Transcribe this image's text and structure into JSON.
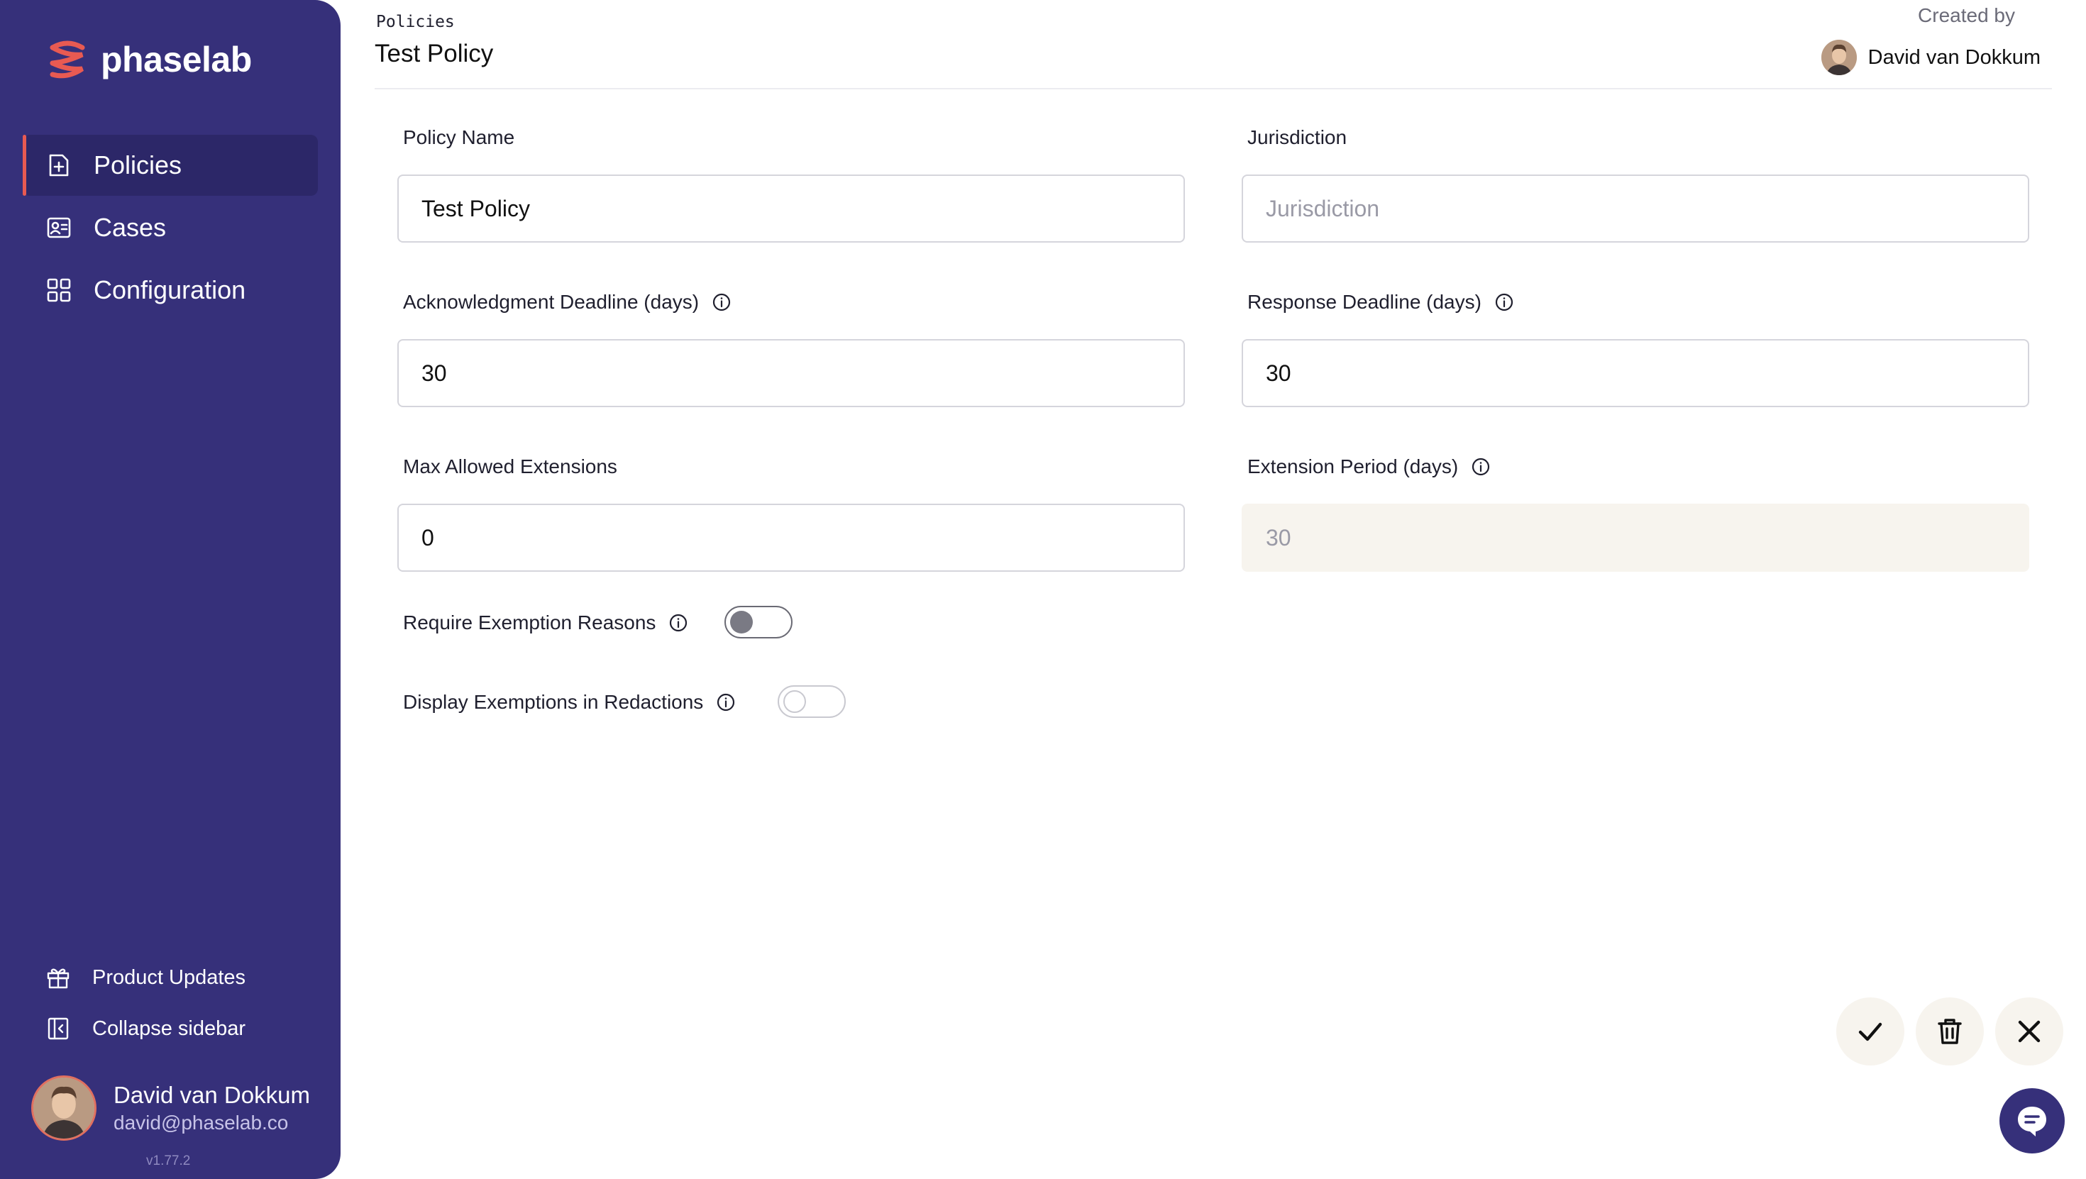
{
  "app": {
    "name": "phaselab",
    "version": "v1.77.2",
    "accent": "#e85a52",
    "sidebar_bg": "#36307a"
  },
  "sidebar": {
    "items": [
      {
        "label": "Policies",
        "icon": "folder-plus-icon",
        "active": true
      },
      {
        "label": "Cases",
        "icon": "contact-card-icon",
        "active": false
      },
      {
        "label": "Configuration",
        "icon": "grid-icon",
        "active": false
      }
    ],
    "bottom": [
      {
        "label": "Product Updates",
        "icon": "gift-icon"
      },
      {
        "label": "Collapse sidebar",
        "icon": "collapse-sidebar-icon"
      }
    ],
    "user": {
      "name": "David van Dokkum",
      "email": "david@phaselab.co"
    }
  },
  "header": {
    "breadcrumb": "Policies",
    "title": "Test Policy",
    "created_by_label": "Created by",
    "created_by_name": "David van Dokkum"
  },
  "form": {
    "policy_name": {
      "label": "Policy Name",
      "value": "Test Policy",
      "placeholder": ""
    },
    "jurisdiction": {
      "label": "Jurisdiction",
      "value": "",
      "placeholder": "Jurisdiction"
    },
    "ack_deadline": {
      "label": "Acknowledgment Deadline (days)",
      "value": "30"
    },
    "response_deadline": {
      "label": "Response Deadline (days)",
      "value": "30"
    },
    "max_extensions": {
      "label": "Max Allowed Extensions",
      "value": "0"
    },
    "extension_period": {
      "label": "Extension Period (days)",
      "value": "30",
      "disabled": true
    },
    "require_exemption": {
      "label": "Require Exemption Reasons",
      "on": false
    },
    "display_exemptions": {
      "label": "Display Exemptions in Redactions",
      "on": false
    }
  },
  "actions": {
    "save": "check-icon",
    "delete": "trash-icon",
    "close": "close-icon",
    "chat": "chat-icon"
  }
}
